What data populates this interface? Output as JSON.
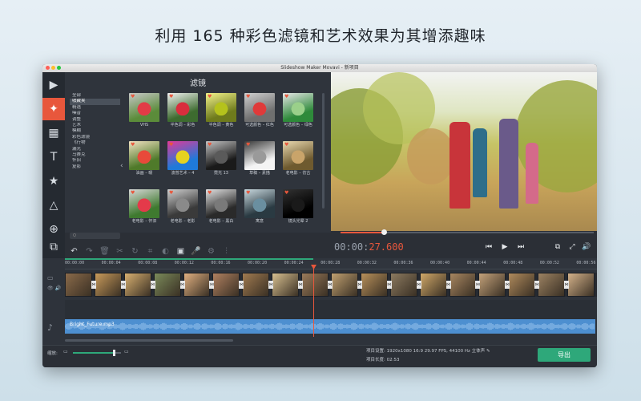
{
  "headline": "利用 165 种彩色滤镜和艺术效果为其增添趣味",
  "window": {
    "title": "Slideshow Maker Movavi - 新项目"
  },
  "tools": [
    {
      "name": "import-media-icon",
      "glyph": "▶"
    },
    {
      "name": "filters-icon",
      "glyph": "✦",
      "active": true
    },
    {
      "name": "transitions-icon",
      "glyph": "▦"
    },
    {
      "name": "titles-icon",
      "glyph": "T"
    },
    {
      "name": "stickers-icon",
      "glyph": "★"
    },
    {
      "name": "shapes-icon",
      "glyph": "△"
    },
    {
      "name": "zoom-pan-icon",
      "glyph": "⊕"
    }
  ],
  "filters_panel": {
    "title": "滤镜",
    "categories": [
      "全部",
      "收藏夹",
      "精选",
      "噪音",
      "调整",
      "艺术",
      "模糊",
      "彩色滤镜",
      "飞行物",
      "漏光",
      "马赛克",
      "怀旧",
      "复影"
    ],
    "selected_category": "收藏夹",
    "search_placeholder": "Q",
    "filters": [
      {
        "label": "VHS",
        "colors": [
          "#5b8c3a",
          "#e23b46",
          "#c7c7c7"
        ]
      },
      {
        "label": "半色调 – 彩色",
        "colors": [
          "#3d6b2f",
          "#d92d3d",
          "#f0f0f0"
        ]
      },
      {
        "label": "半色调 – 黄色",
        "colors": [
          "#6e7a1c",
          "#b5c21c",
          "#f2f28a"
        ]
      },
      {
        "label": "可选颜色 – 红色",
        "colors": [
          "#6f6f6f",
          "#e03a3a",
          "#cfcfcf"
        ]
      },
      {
        "label": "可选颜色 – 绿色",
        "colors": [
          "#2e8a3a",
          "#9ad08a",
          "#e6e6e6"
        ]
      },
      {
        "label": "油画 – 暖",
        "colors": [
          "#4f7a2a",
          "#e84a3a",
          "#f2e2c2"
        ]
      },
      {
        "label": "波普艺术 – 4",
        "colors": [
          "#1f7ad9",
          "#e6d21f",
          "#e03a9a"
        ]
      },
      {
        "label": "霓光 13",
        "colors": [
          "#1a1a1a",
          "#5a5a5a",
          "#c2c2c2"
        ]
      },
      {
        "label": "草稿 – 素描",
        "colors": [
          "#f4f4f4",
          "#9a9a9a",
          "#3a3a3a"
        ]
      },
      {
        "label": "老电影 – 仿古",
        "colors": [
          "#6e5a2f",
          "#c9a46a",
          "#e9d9b0"
        ]
      },
      {
        "label": "老电影 – 怀旧",
        "colors": [
          "#3f7a2f",
          "#e43a4a",
          "#d8d8d8"
        ]
      },
      {
        "label": "老电影 – 老影",
        "colors": [
          "#3a3a3a",
          "#8a8a8a",
          "#cfcfcf"
        ]
      },
      {
        "label": "老电影 – 黑白",
        "colors": [
          "#2a2a2a",
          "#7a7a7a",
          "#e2e2e2"
        ]
      },
      {
        "label": "寓意",
        "colors": [
          "#2a3a42",
          "#6a8fa0",
          "#c8d8de"
        ]
      },
      {
        "label": "镜头光晕 2",
        "colors": [
          "#000000",
          "#1a1a1a",
          "#333333"
        ]
      }
    ]
  },
  "player": {
    "timecode_dim": "00:00:",
    "timecode_hi": "27.600",
    "progress": 0.17,
    "buttons": [
      "skip-back-button",
      "play-button",
      "skip-forward-button"
    ],
    "right_buttons": [
      "detach-preview-button",
      "fullscreen-button",
      "volume-button"
    ]
  },
  "edit_toolbar": [
    {
      "name": "undo-button",
      "glyph": "↶",
      "dim": false
    },
    {
      "name": "redo-button",
      "glyph": "↷",
      "dim": true
    },
    {
      "name": "delete-button",
      "glyph": "🗑",
      "dim": true
    },
    {
      "name": "cut-button",
      "glyph": "✂",
      "dim": true
    },
    {
      "name": "rotate-button",
      "glyph": "↻",
      "dim": true
    },
    {
      "name": "crop-button",
      "glyph": "⌗",
      "dim": true
    },
    {
      "name": "color-adjust-button",
      "glyph": "◐",
      "dim": true
    },
    {
      "name": "clip-properties-button",
      "glyph": "▣",
      "dim": false
    },
    {
      "name": "record-audio-button",
      "glyph": "🎤",
      "dim": false
    },
    {
      "name": "settings-button",
      "glyph": "⚙",
      "dim": true
    },
    {
      "name": "equalizer-button",
      "glyph": "⫶",
      "dim": true
    }
  ],
  "timeline": {
    "ticks": [
      "00:00:00",
      "00:00:04",
      "00:00:08",
      "00:00:12",
      "00:00:16",
      "00:00:20",
      "00:00:24",
      "00:00:28",
      "00:00:32",
      "00:00:36",
      "00:00:40",
      "00:00:44",
      "00:00:48",
      "00:00:52",
      "00:00:56"
    ],
    "audio_file": "Bright_Future.mp3",
    "clip_colors": [
      "#8a6a4a",
      "#c89a5a",
      "#d8b070",
      "#7a8a5a",
      "#e0b080",
      "#b08060",
      "#a07a50",
      "#d8c090",
      "#9a7a5a",
      "#c0a070",
      "#b8905a",
      "#8c7a60",
      "#d0a868",
      "#a88660",
      "#c4a27a",
      "#b08a5c",
      "#9c8262",
      "#d4b28a"
    ]
  },
  "footer": {
    "scale_label": "缩放:",
    "zoom": 0.85,
    "project_settings_label": "项目设置:",
    "project_settings_value": "1920x1080 16:9 29.97 FPS, 44100 Hz 立体声",
    "project_length_label": "项目长度:",
    "project_length_value": "02:53",
    "export_label": "导出"
  },
  "colors": {
    "accent": "#e8573c",
    "export_green": "#2ea87a",
    "audio_blue": "#4d8fd0"
  }
}
